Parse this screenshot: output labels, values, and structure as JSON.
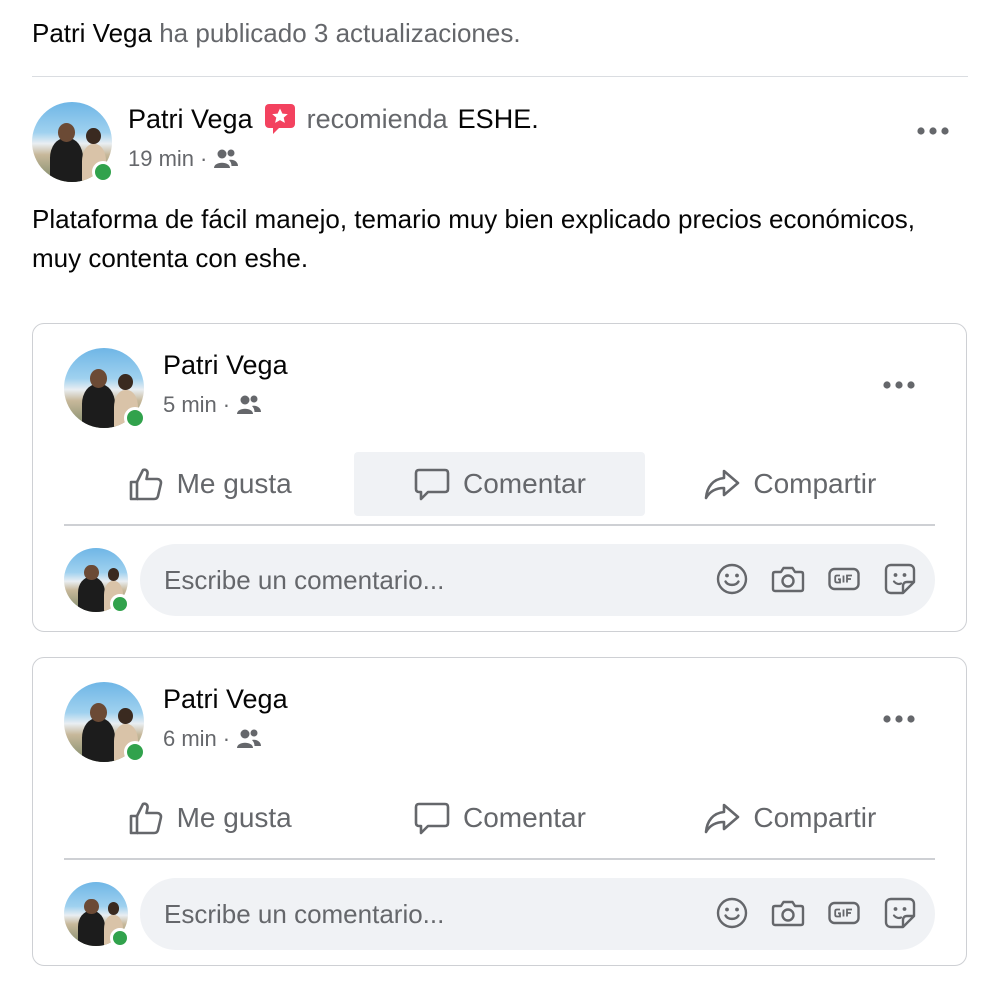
{
  "header": {
    "name": "Patri Vega",
    "text": "ha publicado 3 actualizaciones."
  },
  "main_post": {
    "author": "Patri Vega",
    "badge_icon": "recommendation-star-icon",
    "recommends": "recomienda",
    "page": "ESHE",
    "page_suffix": ".",
    "time": "19 min",
    "separator": "·",
    "audience_icon": "friends-icon",
    "body": "Plataforma de fácil manejo, temario muy bien explicado precios económicos, muy contenta con eshe."
  },
  "cards": [
    {
      "author": "Patri Vega",
      "time": "5 min",
      "separator": "·",
      "actions": {
        "like": "Me gusta",
        "comment": "Comentar",
        "share": "Compartir"
      },
      "comment_placeholder": "Escribe un comentario..."
    },
    {
      "author": "Patri Vega",
      "time": "6 min",
      "separator": "·",
      "actions": {
        "like": "Me gusta",
        "comment": "Comentar",
        "share": "Compartir"
      },
      "comment_placeholder": "Escribe un comentario..."
    }
  ],
  "colors": {
    "secondary_text": "#65676b",
    "online": "#31a24c",
    "badge": "#f3425f",
    "comment_bg": "#f0f2f5"
  }
}
